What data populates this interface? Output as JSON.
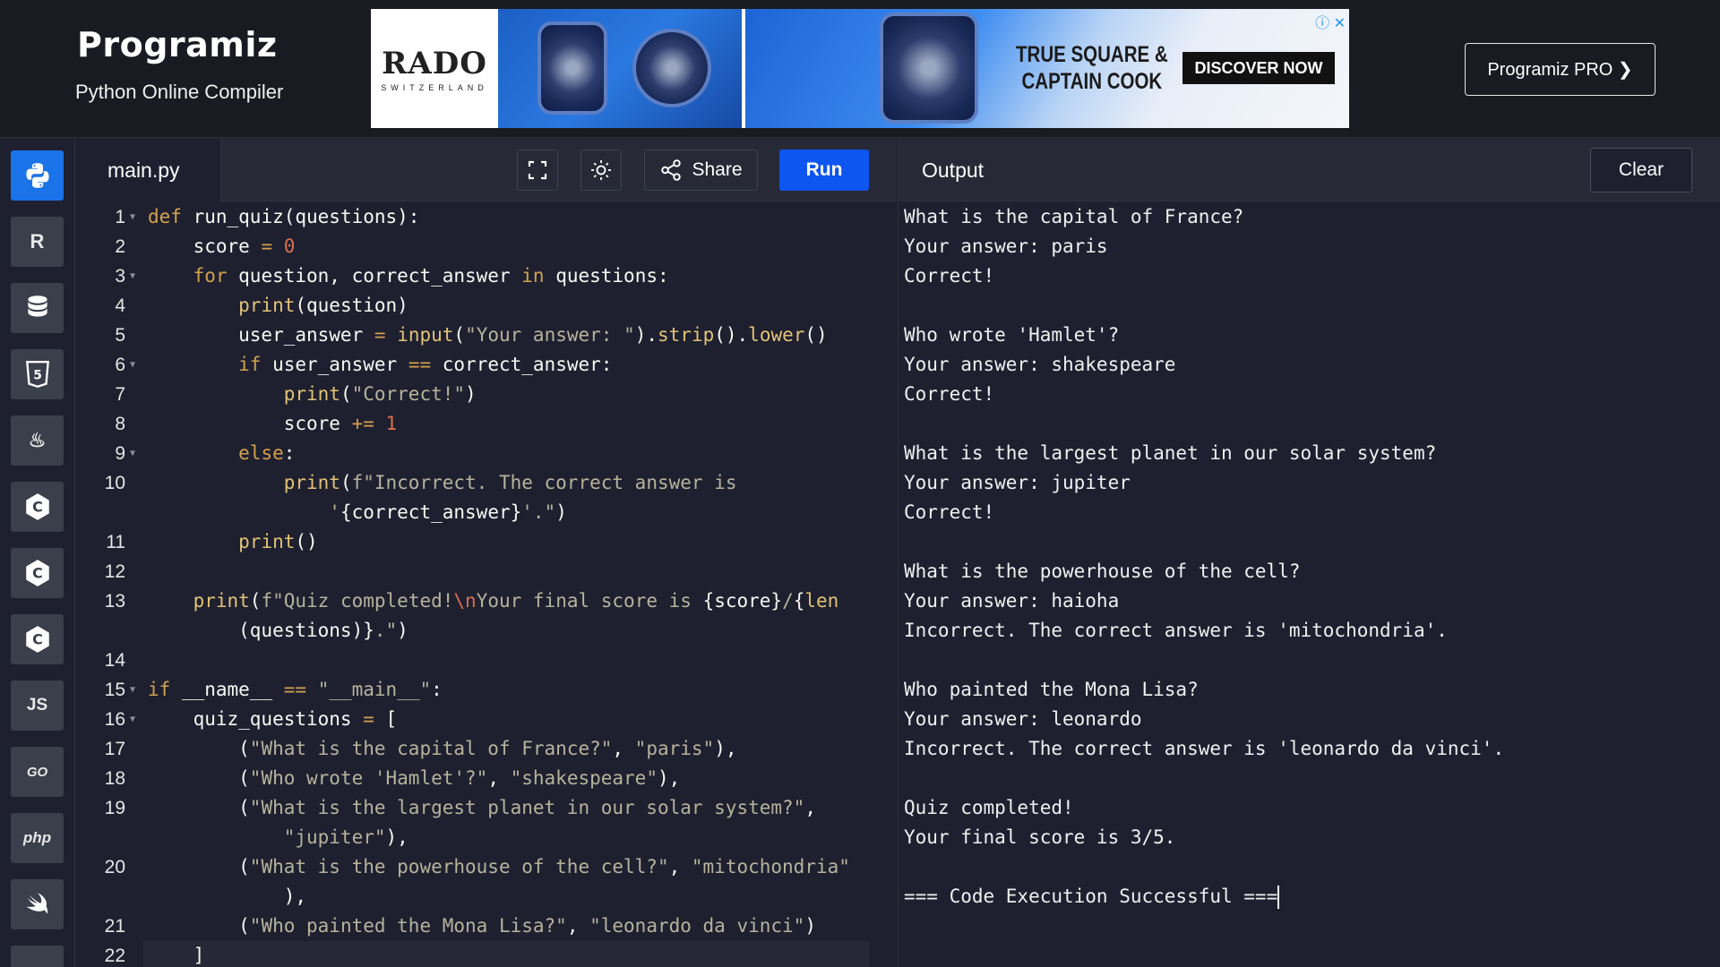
{
  "header": {
    "logo": "Programiz",
    "subtitle": "Python Online Compiler",
    "pro_button": "Programiz PRO ❯"
  },
  "ad": {
    "brand": "RADO",
    "brand_sub": "SWITZERLAND",
    "headline_1": "TRUE SQUARE &",
    "headline_2": "CAPTAIN COOK",
    "cta": "DISCOVER NOW",
    "close": "ⓘ ✕"
  },
  "sidebar": {
    "items": [
      {
        "name": "python",
        "label": "",
        "active": true
      },
      {
        "name": "r",
        "label": "R"
      },
      {
        "name": "sql",
        "label": ""
      },
      {
        "name": "html",
        "label": "5"
      },
      {
        "name": "java",
        "label": "♨"
      },
      {
        "name": "c",
        "label": "C"
      },
      {
        "name": "cpp",
        "label": "C"
      },
      {
        "name": "csharp",
        "label": "C"
      },
      {
        "name": "js",
        "label": "JS"
      },
      {
        "name": "go",
        "label": "GO"
      },
      {
        "name": "php",
        "label": "php"
      },
      {
        "name": "swift",
        "label": ""
      }
    ]
  },
  "editor": {
    "file_tab": "main.py",
    "share_label": "Share",
    "run_label": "Run",
    "line_numbers": [
      "1",
      "2",
      "3",
      "4",
      "5",
      "6",
      "7",
      "8",
      "9",
      "10",
      "11",
      "12",
      "13",
      "14",
      "15",
      "16",
      "17",
      "18",
      "19",
      "20",
      "21",
      "22"
    ]
  },
  "output": {
    "title": "Output",
    "clear_label": "Clear",
    "lines": [
      "What is the capital of France?",
      "Your answer: paris",
      "Correct!",
      "",
      "Who wrote 'Hamlet'?",
      "Your answer: shakespeare",
      "Correct!",
      "",
      "What is the largest planet in our solar system?",
      "Your answer: jupiter",
      "Correct!",
      "",
      "What is the powerhouse of the cell?",
      "Your answer: haioha",
      "Incorrect. The correct answer is 'mitochondria'.",
      "",
      "Who painted the Mona Lisa?",
      "Your answer: leonardo",
      "Incorrect. The correct answer is 'leonardo da vinci'.",
      "",
      "Quiz completed!",
      "Your final score is 3/5.",
      "",
      "=== Code Execution Successful ==="
    ]
  },
  "colors": {
    "run_button": "#0f55f1",
    "active_lang": "#1a73e8",
    "keyword": "#d4a14e",
    "string": "#b6b39b",
    "number": "#d96f4d"
  }
}
